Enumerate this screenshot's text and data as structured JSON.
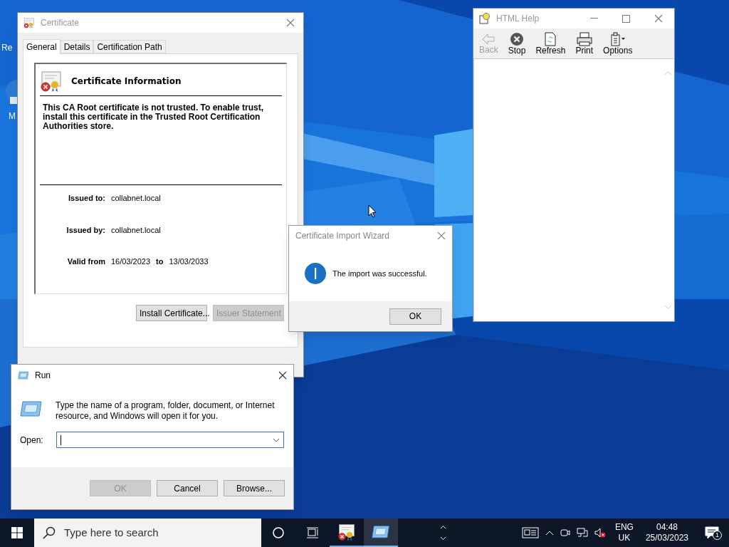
{
  "desktop": {
    "icons": [
      {
        "label": "Re"
      },
      {
        "label": "M"
      }
    ]
  },
  "certificate_window": {
    "title": "Certificate",
    "tabs": [
      {
        "label": "General",
        "selected": true
      },
      {
        "label": "Details",
        "selected": false
      },
      {
        "label": "Certification Path",
        "selected": false
      }
    ],
    "heading": "Certificate Information",
    "message": "This CA Root certificate is not trusted. To enable trust, install this certificate in the Trusted Root Certification Authorities store.",
    "fields": [
      {
        "label": "Issued to:",
        "value": "collabnet.local"
      },
      {
        "label": "Issued by:",
        "value": "collabnet.local"
      }
    ],
    "validity": {
      "label": "Valid from",
      "from": "16/03/2023",
      "to_label": "to",
      "to": "13/03/2033"
    },
    "buttons": [
      {
        "label": "Install Certificate...",
        "disabled": false
      },
      {
        "label": "Issuer Statement",
        "disabled": true
      }
    ]
  },
  "help_window": {
    "title": "HTML Help",
    "toolbar": [
      {
        "kind": "back",
        "label": "Back",
        "disabled": true
      },
      {
        "kind": "stop",
        "label": "Stop",
        "disabled": false
      },
      {
        "kind": "refresh",
        "label": "Refresh",
        "disabled": false
      },
      {
        "kind": "print",
        "label": "Print",
        "disabled": false
      },
      {
        "kind": "options",
        "label": "Options",
        "disabled": false
      }
    ]
  },
  "import_wizard": {
    "title": "Certificate Import Wizard",
    "message": "The import was successful.",
    "button": "OK"
  },
  "run_dialog": {
    "title": "Run",
    "description": "Type the name of a program, folder, document, or Internet resource, and Windows will open it for you.",
    "open_label": "Open:",
    "buttons": [
      {
        "label": "OK",
        "disabled": true
      },
      {
        "label": "Cancel",
        "disabled": false
      },
      {
        "label": "Browse...",
        "disabled": false
      }
    ]
  },
  "taskbar": {
    "search_placeholder": "Type here to search",
    "apps": [
      {
        "kind": "certificate",
        "selected": false
      },
      {
        "kind": "run",
        "selected": true
      }
    ],
    "language": "ENG",
    "region": "UK",
    "time": "04:48",
    "date": "25/03/2023",
    "notification_count": "1"
  }
}
